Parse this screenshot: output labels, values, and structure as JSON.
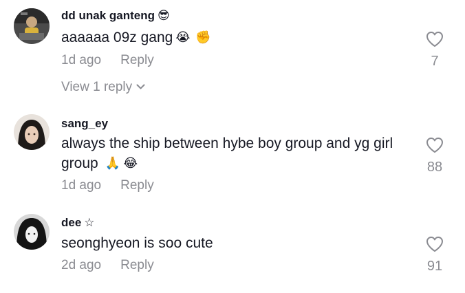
{
  "comments": [
    {
      "username": "dd unak ganteng",
      "name_emoji": "😎",
      "text": "aaaaaa 09z gang",
      "text_emojis": [
        "😭",
        "✊"
      ],
      "time": "1d ago",
      "reply_label": "Reply",
      "likes": "7",
      "view_replies": "View 1 reply"
    },
    {
      "username": "sang_ey",
      "text": "always the ship between hybe boy group and yg girl group",
      "text_emojis": [
        "🙏",
        "😂"
      ],
      "time": "1d ago",
      "reply_label": "Reply",
      "likes": "88"
    },
    {
      "username": "dee",
      "name_deco": "☆",
      "text": "seonghyeon is soo cute",
      "time": "2d ago",
      "reply_label": "Reply",
      "likes": "91"
    }
  ],
  "icons": {
    "like": "heart-outline-icon",
    "expand": "chevron-down-icon"
  },
  "colors": {
    "text": "#161823",
    "muted": "#8a8b91"
  }
}
